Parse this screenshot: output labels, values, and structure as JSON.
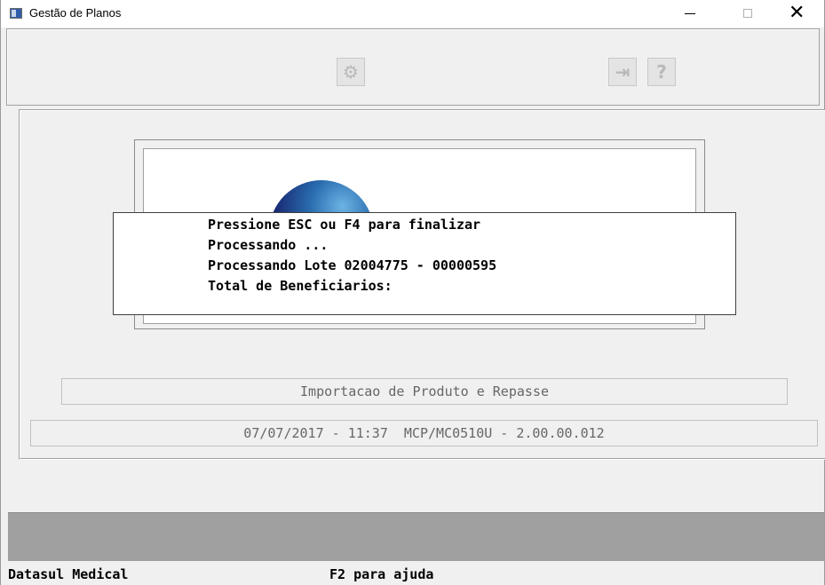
{
  "window": {
    "title": "Gestão de Planos",
    "minimize_glyph": "—",
    "maximize_glyph": "☐",
    "close_glyph": "✕"
  },
  "toolbar": {
    "buttons": [
      {
        "name": "process",
        "icon": "gears-icon",
        "glyph": "⚙"
      },
      {
        "name": "exit",
        "icon": "exit-door-icon",
        "glyph": "⇥"
      },
      {
        "name": "help",
        "icon": "help-icon",
        "glyph": "?"
      }
    ]
  },
  "dialog": {
    "line1": "Pressione ESC ou F4 para finalizar",
    "line2": "Processando ...",
    "line3": "Processando Lote 02004775 - 00000595",
    "line4": "Total de Beneficiarios:"
  },
  "program": {
    "name": "Importacao de Produto e Repasse",
    "version_line": "07/07/2017 - 11:37  MCP/MC0510U - 2.00.00.012"
  },
  "statusbar": {
    "company": "Datasul Medical",
    "help_hint": "F2 para ajuda"
  },
  "colors": {
    "window_bg": "#f0f0f0",
    "band": "#a0a0a0",
    "logo_globe": "#17246e"
  }
}
